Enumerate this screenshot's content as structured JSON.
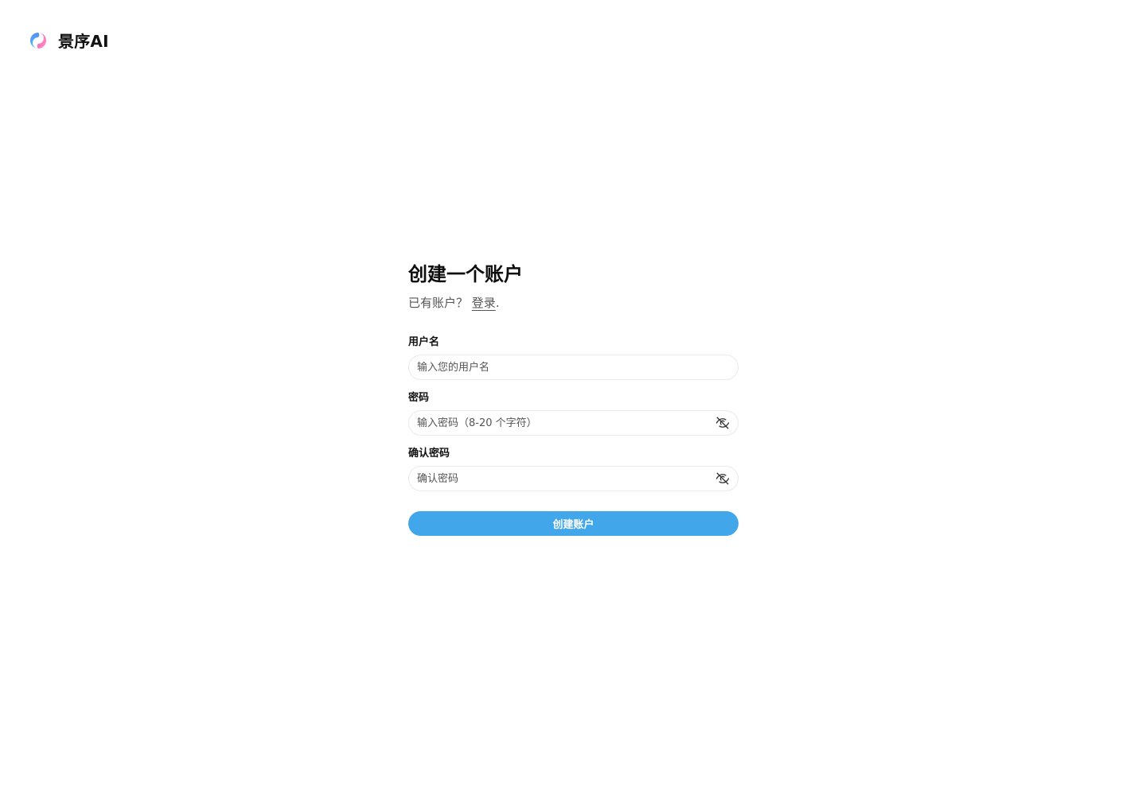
{
  "brand": {
    "name": "景序AI",
    "icon": "gradient-ring-logo",
    "gradient": [
      "#7b7ff7",
      "#ff6fb5",
      "#43c6f0"
    ]
  },
  "form": {
    "title": "创建一个账户",
    "subtitle_prefix": "已有账户？",
    "login_link": "登录",
    "subtitle_suffix": ".",
    "username": {
      "label": "用户名",
      "placeholder": "输入您的用户名",
      "value": ""
    },
    "password": {
      "label": "密码",
      "placeholder": "输入密码（8-20 个字符）",
      "value": "",
      "toggle_icon": "eye-off-icon"
    },
    "confirm": {
      "label": "确认密码",
      "placeholder": "确认密码",
      "value": "",
      "toggle_icon": "eye-off-icon"
    },
    "submit_label": "创建账户"
  },
  "colors": {
    "accent": "#41a6ea",
    "border": "#e9e9e9",
    "text": "#111111",
    "muted": "#555555"
  }
}
